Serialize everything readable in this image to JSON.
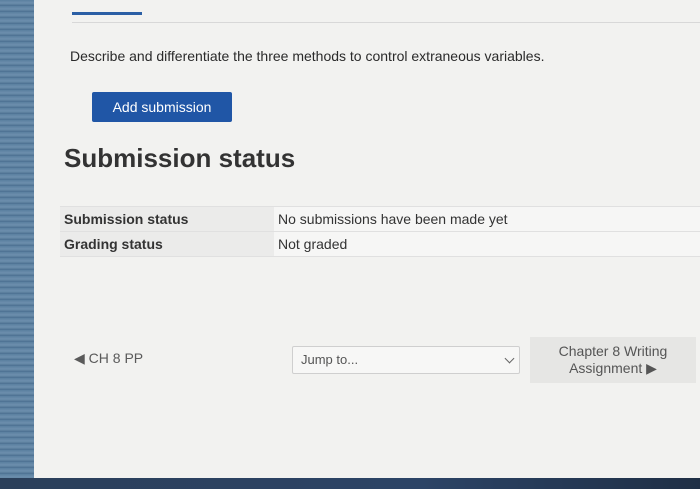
{
  "question": "Describe and differentiate the three methods to control extraneous variables.",
  "add_submission_label": "Add submission",
  "section_heading": "Submission status",
  "status_table": [
    {
      "label": "Submission status",
      "value": "No submissions have been made yet"
    },
    {
      "label": "Grading status",
      "value": "Not graded"
    }
  ],
  "nav": {
    "prev_label": "◀ CH 8 PP",
    "jump_placeholder": "Jump to...",
    "next_line1": "Chapter 8 Writing",
    "next_line2": "Assignment ▶"
  },
  "colors": {
    "accent": "#2056a6",
    "background": "#f2f2f0"
  }
}
